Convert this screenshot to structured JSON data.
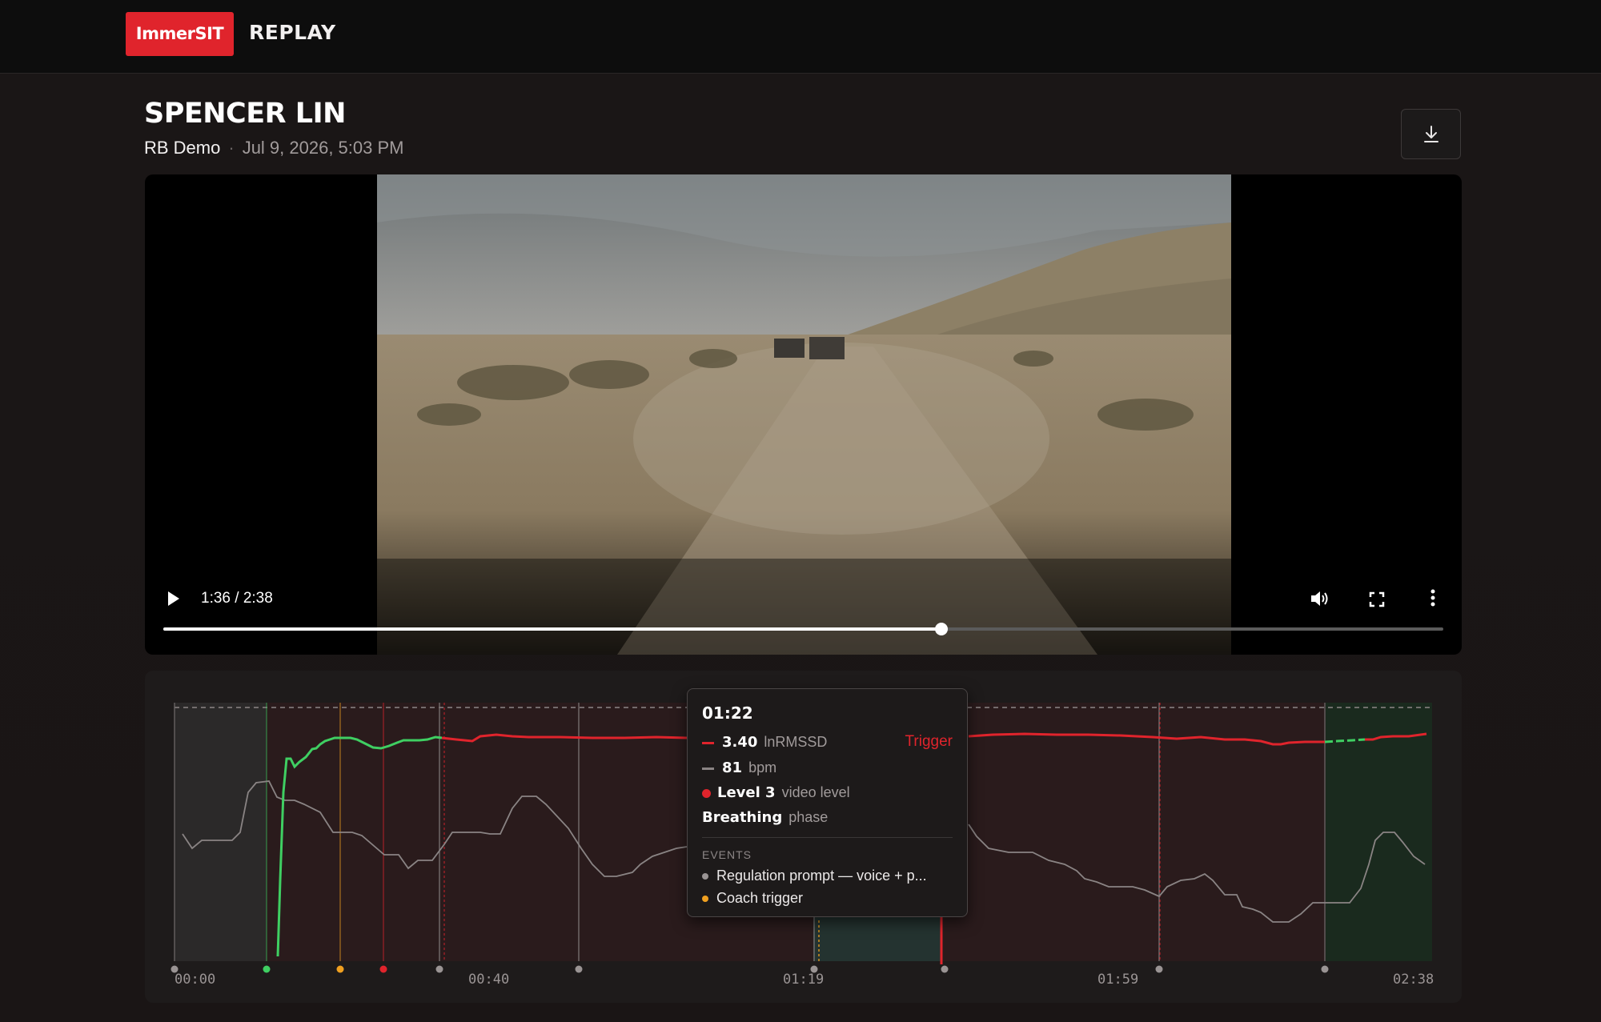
{
  "app": {
    "logo_text": "ImmerSIT",
    "title": "REPLAY"
  },
  "session": {
    "name": "SPENCER LIN",
    "program": "RB Demo",
    "separator": "·",
    "date": "Jul 9, 2026, 5:03 PM"
  },
  "player": {
    "time_display": "1:36 / 2:38",
    "progress": 0.608,
    "icons": [
      "play-icon",
      "volume-icon",
      "fullscreen-icon",
      "more-options-icon"
    ]
  },
  "timeline": {
    "tick_labels": [
      "00:00",
      "00:40",
      "01:19",
      "01:59",
      "02:38"
    ],
    "colors": {
      "lnrmssd": "#e0242c",
      "lnrmssd_ok": "#3fcf62",
      "bpm": "#8a8484",
      "coach": "#f0a020",
      "event": "#9a9494"
    }
  },
  "tooltip": {
    "time": "01:22",
    "lnrmssd_value": "3.40",
    "lnrmssd_unit": "lnRMSSD",
    "lnrmssd_status": "Trigger",
    "bpm_value": "81",
    "bpm_unit": "bpm",
    "level_value": "Level 3",
    "level_unit": "video level",
    "phase_value": "Breathing",
    "phase_unit": "phase",
    "events_heading": "EVENTS",
    "events": [
      {
        "label": "Regulation prompt — voice + p...",
        "color": "#9a9494"
      },
      {
        "label": "Coach trigger",
        "color": "#f0a020"
      }
    ]
  }
}
